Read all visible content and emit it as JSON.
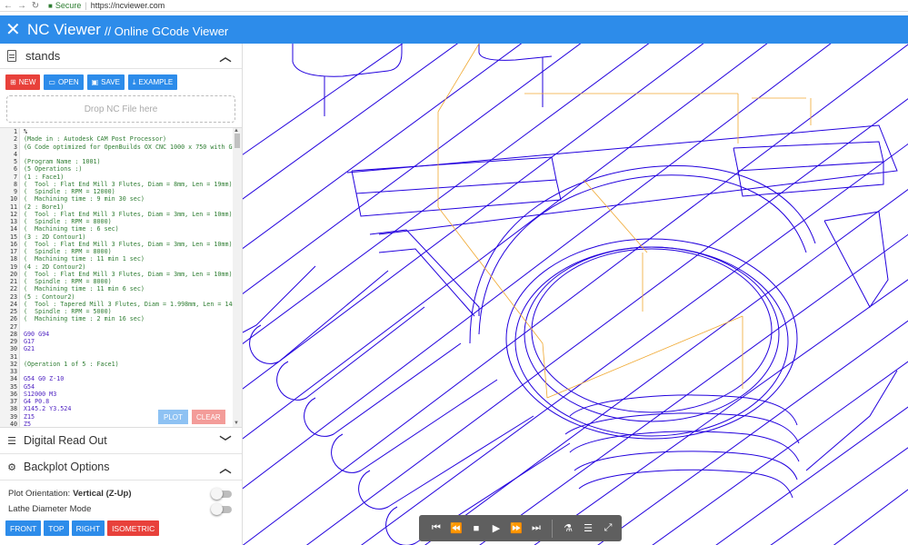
{
  "browser": {
    "secure_label": "Secure",
    "url": "https://ncviewer.com"
  },
  "header": {
    "title": "NC Viewer",
    "subtitle": "// Online GCode Viewer"
  },
  "file": {
    "name": "stands"
  },
  "buttons": {
    "new": "NEW",
    "open": "OPEN",
    "save": "SAVE",
    "example": "EXAMPLE"
  },
  "dropzone": "Drop NC File here",
  "code": [
    {
      "n": "1",
      "t": "%",
      "c": "k"
    },
    {
      "n": "2",
      "t": "(Made in : Autodesk CAM Post Processor)",
      "c": "c"
    },
    {
      "n": "3",
      "t": "(G Code optimized for OpenBuilds OX CNC 1000 x 750 with GR",
      "c": "c"
    },
    {
      "n": "4",
      "t": "",
      "c": "c"
    },
    {
      "n": "5",
      "t": "(Program Name : 1001)",
      "c": "c"
    },
    {
      "n": "6",
      "t": "(5 Operations :)",
      "c": "c"
    },
    {
      "n": "7",
      "t": "(1 : Face1)",
      "c": "c"
    },
    {
      "n": "8",
      "t": "(  Tool : Flat End Mill 3 Flutes, Diam = 8mm, Len = 19mm)",
      "c": "c"
    },
    {
      "n": "9",
      "t": "(  Spindle : RPM = 12000)",
      "c": "c"
    },
    {
      "n": "10",
      "t": "(  Machining time : 9 min 30 sec)",
      "c": "c"
    },
    {
      "n": "11",
      "t": "(2 : Bore1)",
      "c": "c"
    },
    {
      "n": "12",
      "t": "(  Tool : Flat End Mill 3 Flutes, Diam = 3mm, Len = 10mm)",
      "c": "c"
    },
    {
      "n": "13",
      "t": "(  Spindle : RPM = 8000)",
      "c": "c"
    },
    {
      "n": "14",
      "t": "(  Machining time : 6 sec)",
      "c": "c"
    },
    {
      "n": "15",
      "t": "(3 : 2D Contour1)",
      "c": "c"
    },
    {
      "n": "16",
      "t": "(  Tool : Flat End Mill 3 Flutes, Diam = 3mm, Len = 10mm)",
      "c": "c"
    },
    {
      "n": "17",
      "t": "(  Spindle : RPM = 8000)",
      "c": "c"
    },
    {
      "n": "18",
      "t": "(  Machining time : 11 min 1 sec)",
      "c": "c"
    },
    {
      "n": "19",
      "t": "(4 : 2D Contour2)",
      "c": "c"
    },
    {
      "n": "20",
      "t": "(  Tool : Flat End Mill 3 Flutes, Diam = 3mm, Len = 10mm)",
      "c": "c"
    },
    {
      "n": "21",
      "t": "(  Spindle : RPM = 8000)",
      "c": "c"
    },
    {
      "n": "22",
      "t": "(  Machining time : 11 min 6 sec)",
      "c": "c"
    },
    {
      "n": "23",
      "t": "(5 : Contour2)",
      "c": "c"
    },
    {
      "n": "24",
      "t": "(  Tool : Tapered Mill 3 Flutes, Diam = 1.998mm, Len = 14m",
      "c": "c"
    },
    {
      "n": "25",
      "t": "(  Spindle : RPM = 5000)",
      "c": "c"
    },
    {
      "n": "26",
      "t": "(  Machining time : 2 min 16 sec)",
      "c": "c"
    },
    {
      "n": "27",
      "t": "",
      "c": "c"
    },
    {
      "n": "28",
      "t": "G90 G94",
      "c": "g"
    },
    {
      "n": "29",
      "t": "G17",
      "c": "g"
    },
    {
      "n": "30",
      "t": "G21",
      "c": "g"
    },
    {
      "n": "31",
      "t": "",
      "c": "c"
    },
    {
      "n": "32",
      "t": "(Operation 1 of 5 : Face1)",
      "c": "c"
    },
    {
      "n": "33",
      "t": "",
      "c": "c"
    },
    {
      "n": "34",
      "t": "G54 G0 Z-10",
      "c": "g"
    },
    {
      "n": "35",
      "t": "G54",
      "c": "g"
    },
    {
      "n": "36",
      "t": "S12000 M3",
      "c": "g"
    },
    {
      "n": "37",
      "t": "G4 P0.8",
      "c": "g"
    },
    {
      "n": "38",
      "t": "X145.2 Y3.524",
      "c": "g"
    },
    {
      "n": "39",
      "t": "Z15",
      "c": "g"
    },
    {
      "n": "40",
      "t": "Z5",
      "c": "g"
    }
  ],
  "editor_buttons": {
    "plot": "PLOT",
    "clear": "CLEAR"
  },
  "sections": {
    "dro": "Digital Read Out",
    "backplot": "Backplot Options"
  },
  "options": {
    "orientation_label": "Plot Orientation:",
    "orientation_value": "Vertical (Z-Up)",
    "lathe_label": "Lathe Diameter Mode"
  },
  "view_buttons": {
    "front": "FRONT",
    "top": "TOP",
    "right": "RIGHT",
    "isometric": "ISOMETRIC"
  },
  "colors": {
    "header": "#2d8cea",
    "danger": "#e8413b",
    "toolpath": "#2200dd",
    "rapid": "#f0a830"
  }
}
